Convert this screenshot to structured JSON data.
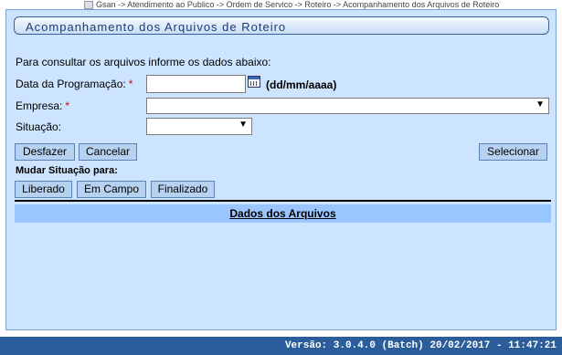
{
  "breadcrumb": "Gsan -> Atendimento ao Publico -> Ordem de Servico -> Roteiro -> Acompanhamento dos Arquivos de Roteiro",
  "title": "Acompanhamento dos Arquivos de Roteiro",
  "intro": "Para consultar os arquivos informe os dados abaixo:",
  "form": {
    "date_label": "Data da Programação:",
    "date_value": "",
    "date_hint": "(dd/mm/aaaa)",
    "empresa_label": "Empresa:",
    "empresa_value": "",
    "situacao_label": "Situação:",
    "situacao_value": "",
    "required_mark": "*"
  },
  "buttons": {
    "desfazer": "Desfazer",
    "cancelar": "Cancelar",
    "selecionar": "Selecionar",
    "liberado": "Liberado",
    "em_campo": "Em Campo",
    "finalizado": "Finalizado"
  },
  "mudar_label": "Mudar Situação para:",
  "table_header": "Dados dos Arquivos",
  "footer": "Versão: 3.0.4.0 (Batch) 20/02/2017 - 11:47:21",
  "icons": {
    "dropdown": "▼",
    "calendar": "calendar-icon"
  }
}
